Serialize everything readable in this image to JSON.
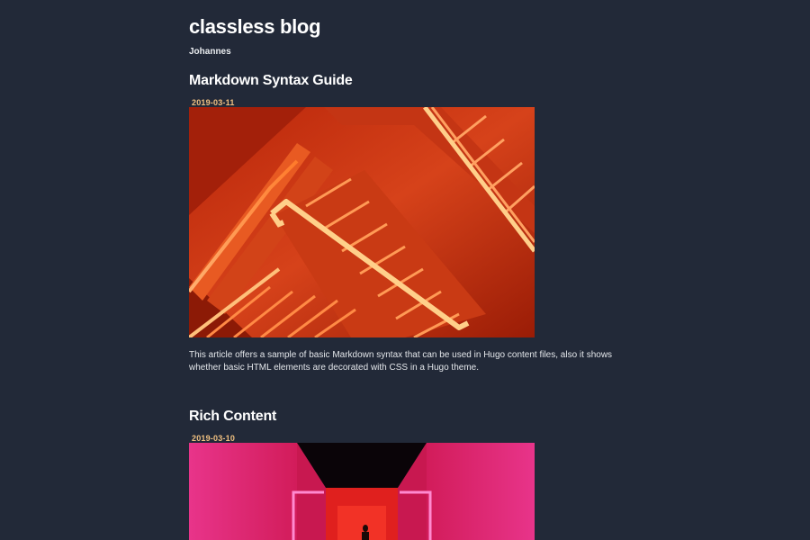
{
  "site": {
    "title": "classless blog",
    "author": "Johannes"
  },
  "posts": [
    {
      "title": "Markdown Syntax Guide",
      "date": "2019-03-11",
      "summary": "This article offers a sample of basic Markdown syntax that can be used in Hugo content files, also it shows whether basic HTML elements are decorated with CSS in a Hugo theme."
    },
    {
      "title": "Rich Content",
      "date": "2019-03-10"
    }
  ],
  "colors": {
    "background": "#222938",
    "text": "#e9ecef",
    "date_accent": "#f0c080",
    "stair_orange": "#e0401a",
    "corridor_pink": "#e02a78"
  }
}
